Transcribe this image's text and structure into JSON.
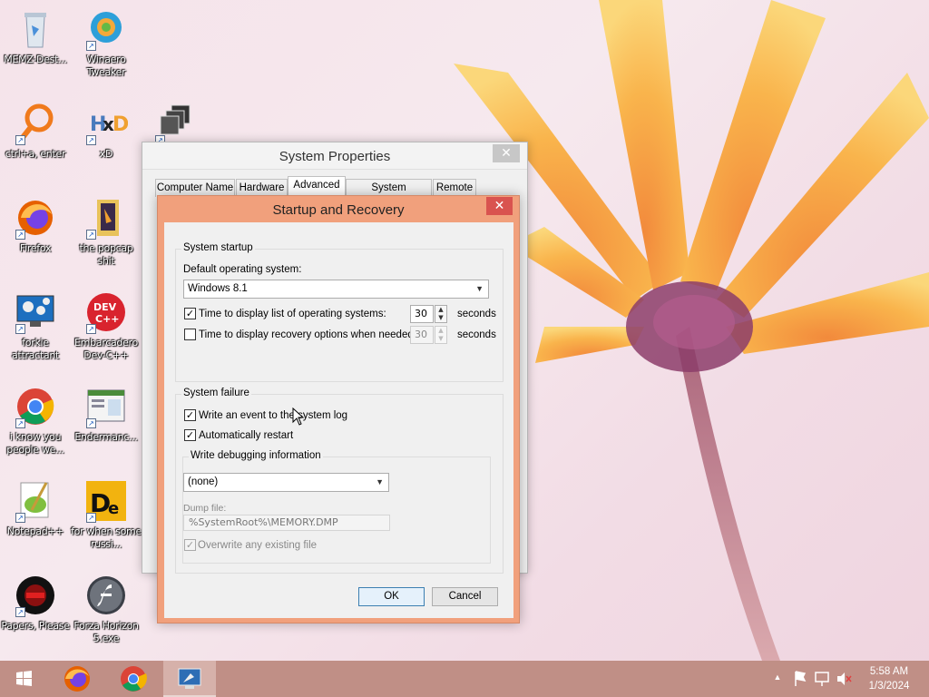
{
  "desktop": {
    "icons": [
      {
        "label": "MEMZ-Dest..."
      },
      {
        "label": "Winaero Tweaker"
      },
      {
        "label": "ctrl+a, enter"
      },
      {
        "label": "xD"
      },
      {
        "label": ""
      },
      {
        "label": "Firefox"
      },
      {
        "label": "the popcap shit"
      },
      {
        "label": "forkie attractant"
      },
      {
        "label": "Embarcadero Dev-C++"
      },
      {
        "label": "i know you people we..."
      },
      {
        "label": "Endermanc..."
      },
      {
        "label": "Notepad++"
      },
      {
        "label": "for when some russi..."
      },
      {
        "label": "Papers, Please"
      },
      {
        "label": "Forza Horizon 5.exe"
      }
    ]
  },
  "system_properties": {
    "title": "System Properties",
    "tabs": [
      "Computer Name",
      "Hardware",
      "Advanced",
      "System Protection",
      "Remote"
    ],
    "active_tab": "Advanced"
  },
  "startup_recovery": {
    "title": "Startup and Recovery",
    "system_startup": {
      "group_label": "System startup",
      "default_os_label": "Default operating system:",
      "default_os_value": "Windows 8.1",
      "display_list_label": "Time to display list of operating systems:",
      "display_list_checked": true,
      "display_list_value": "30",
      "display_recovery_label": "Time to display recovery options when needed:",
      "display_recovery_checked": false,
      "display_recovery_value": "30",
      "seconds": "seconds"
    },
    "system_failure": {
      "group_label": "System failure",
      "write_event_label": "Write an event to the system log",
      "write_event_checked": true,
      "auto_restart_label": "Automatically restart",
      "auto_restart_checked": true,
      "debug_group_label": "Write debugging information",
      "debug_value": "(none)",
      "dump_file_label": "Dump file:",
      "dump_file_value": "%SystemRoot%\\MEMORY.DMP",
      "overwrite_label": "Overwrite any existing file",
      "overwrite_checked": true
    },
    "ok_label": "OK",
    "cancel_label": "Cancel"
  },
  "taskbar": {
    "time": "5:58 AM",
    "date": "1/3/2024",
    "color": "#c08f86"
  },
  "colors": {
    "dialog_accent": "#f1a07c",
    "close_red": "#d9534f"
  }
}
